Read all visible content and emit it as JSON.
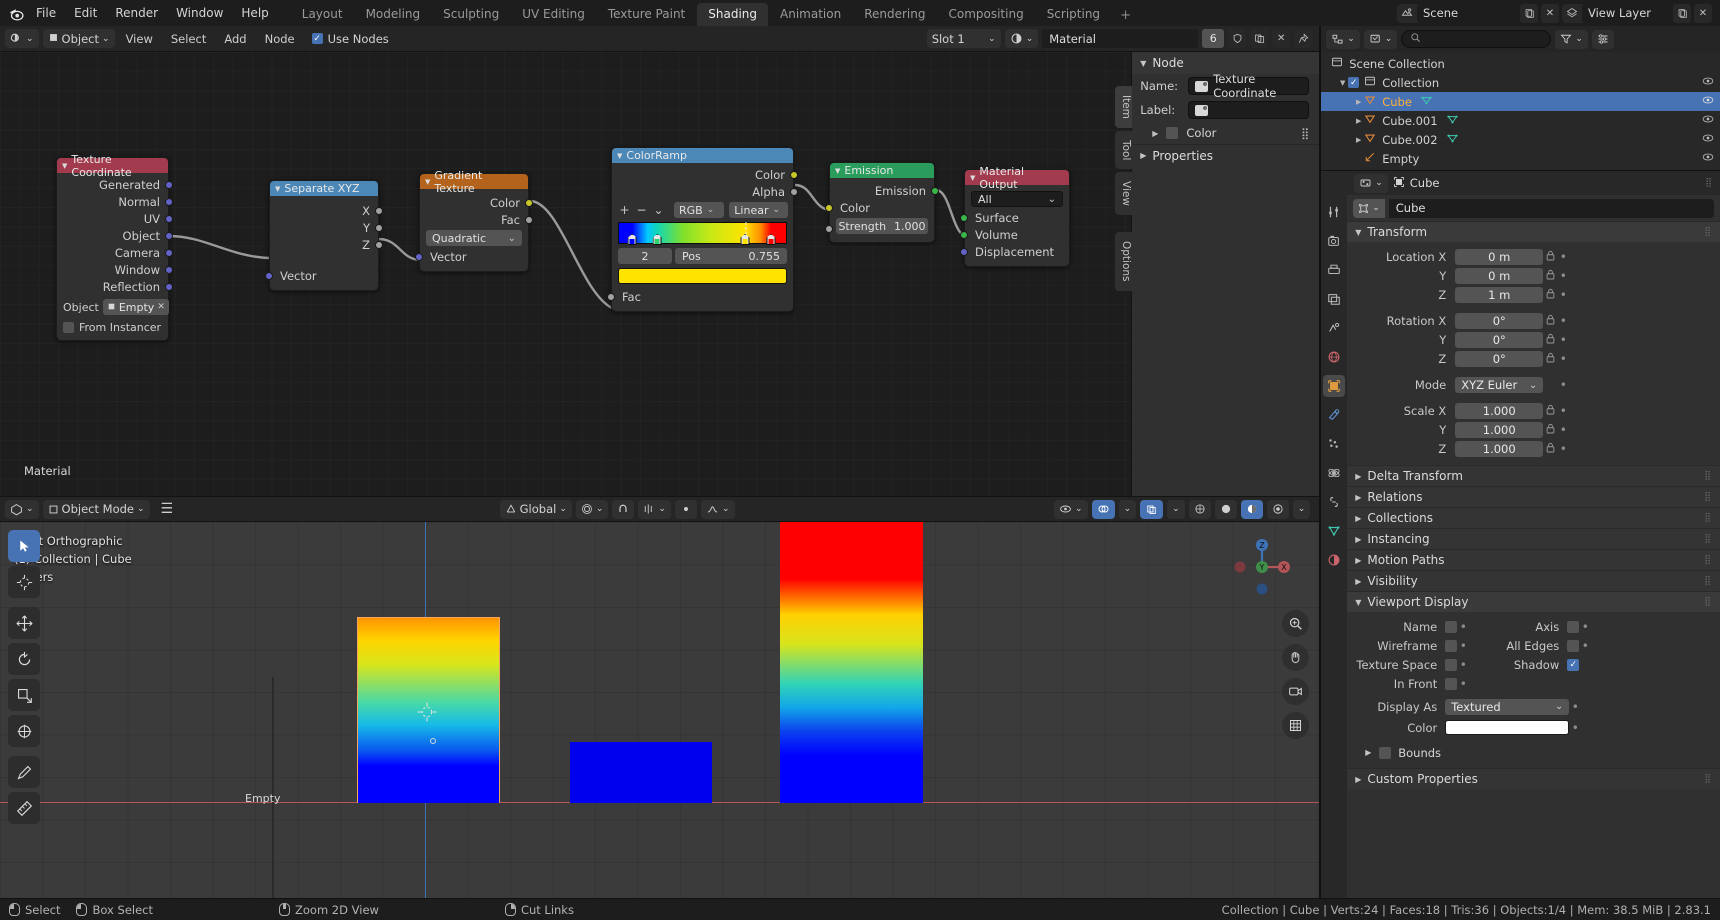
{
  "topbar": {
    "logo_icon": "blender-logo-icon",
    "menus": [
      "File",
      "Edit",
      "Render",
      "Window",
      "Help"
    ],
    "workspaces": [
      "Layout",
      "Modeling",
      "Sculpting",
      "UV Editing",
      "Texture Paint",
      "Shading",
      "Animation",
      "Rendering",
      "Compositing",
      "Scripting"
    ],
    "active_workspace": "Shading",
    "add_workspace": "+",
    "scene_name": "Scene",
    "viewlayer_name": "View Layer"
  },
  "node_header": {
    "editor_type_icon": "shader-editor-icon",
    "shader_type": "Object",
    "menus": [
      "View",
      "Select",
      "Add",
      "Node"
    ],
    "use_nodes_label": "Use Nodes",
    "use_nodes_checked": true,
    "slot": "Slot 1",
    "material_name": "Material",
    "users_count": "6",
    "shield_icon": "fake-user-icon",
    "copy_icon": "duplicate-icon",
    "x_icon": "unlink-icon",
    "pin_icon": "pin-icon"
  },
  "nodes": {
    "texture_coordinate": {
      "title": "Texture Coordinate",
      "header_color": "#a33b4e",
      "outputs": [
        "Generated",
        "Normal",
        "UV",
        "Object",
        "Camera",
        "Window",
        "Reflection"
      ],
      "object_label": "Object",
      "object_value": "Empty",
      "from_instancer_label": "From Instancer",
      "from_instancer_checked": false
    },
    "separate_xyz": {
      "title": "Separate XYZ",
      "header_color": "#4b87b7",
      "outputs": [
        "X",
        "Y",
        "Z"
      ],
      "inputs": [
        "Vector"
      ]
    },
    "gradient_texture": {
      "title": "Gradient Texture",
      "header_color": "#b3631b",
      "outputs": [
        "Color",
        "Fac"
      ],
      "type_value": "Quadratic",
      "inputs": [
        "Vector"
      ]
    },
    "color_ramp": {
      "title": "ColorRamp",
      "header_color": "#4b87b7",
      "outputs": [
        "Color",
        "Alpha"
      ],
      "inputs": [
        "Fac"
      ],
      "add_icon": "plus-icon",
      "remove_icon": "minus-icon",
      "dropdown_icon": "chevron-down-icon",
      "color_mode": "RGB",
      "interpolation": "Linear",
      "active_index": "2",
      "pos_label": "Pos",
      "pos_value": "0.755",
      "active_color": "#ffe400",
      "stops": [
        {
          "pos": 0.08,
          "color": "#0000ff",
          "selected": false
        },
        {
          "pos": 0.23,
          "color": "#2fd36e",
          "selected": false
        },
        {
          "pos": 0.755,
          "color": "#ffe400",
          "selected": true
        },
        {
          "pos": 0.91,
          "color": "#ff0000",
          "selected": false
        }
      ]
    },
    "emission": {
      "title": "Emission",
      "header_color": "#2a9d5c",
      "outputs": [
        "Emission"
      ],
      "inputs": [
        "Color"
      ],
      "strength_label": "Strength",
      "strength_value": "1.000"
    },
    "material_output": {
      "title": "Material Output",
      "header_color": "#a33b4e",
      "target_value": "All",
      "inputs": [
        "Surface",
        "Volume",
        "Displacement"
      ]
    }
  },
  "node_npanel": {
    "tabs": [
      "Item",
      "Tool",
      "View",
      "Options"
    ],
    "section_node": "Node",
    "name_label": "Name:",
    "name_value": "Texture Coordinate",
    "label_label": "Label:",
    "label_value": "",
    "color_label": "Color",
    "color_checked": false,
    "properties_label": "Properties",
    "list_icon": "list-icon"
  },
  "viewport_label": "Material",
  "viewport_header": {
    "editor_icon": "3d-viewport-icon",
    "mode": "Object Mode",
    "menu_icon": "hamburger-icon",
    "transform_orientation": "Global",
    "snap_icon": "magnet-icon",
    "proportional_icon": "proportional-edit-icon",
    "falloff_icon": "falloff-curve-icon",
    "overlay_icon": "overlays-icon",
    "xray_icon": "xray-icon",
    "shading_icons": [
      "wireframe-shading",
      "solid-shading",
      "material-preview-shading",
      "rendered-shading"
    ]
  },
  "viewport": {
    "info_line1": "Front Orthographic",
    "info_line2": "(1) Collection | Cube",
    "info_line3": "Meters",
    "empty_label": "Empty",
    "gizmo_axes": [
      "X",
      "Y",
      "Z"
    ],
    "tools": [
      "select-box-tool",
      "cursor-tool",
      "move-tool",
      "rotate-tool",
      "scale-tool",
      "transform-tool",
      "annotate-tool",
      "measure-tool"
    ],
    "overlay_buttons": [
      "zoom-icon",
      "hand-icon",
      "camera-icon",
      "grid-icon"
    ]
  },
  "outliner": {
    "display_mode_icon": "outliner-display-mode-icon",
    "filter_icon": "filter-icon",
    "search_placeholder": "",
    "search_icon": "search-icon",
    "rows": [
      {
        "label": "Scene Collection",
        "icon": "collection-icon",
        "depth": 0,
        "selected": false,
        "expandable": false,
        "checkbox": false,
        "visible": true
      },
      {
        "label": "Collection",
        "icon": "collection-icon",
        "depth": 1,
        "selected": false,
        "expandable": true,
        "checkbox": true,
        "visible": true
      },
      {
        "label": "Cube",
        "icon": "mesh-icon",
        "depth": 2,
        "selected": true,
        "expandable": true,
        "checkbox": false,
        "visible": true
      },
      {
        "label": "Cube.001",
        "icon": "mesh-icon",
        "depth": 2,
        "selected": false,
        "expandable": true,
        "checkbox": false,
        "visible": true
      },
      {
        "label": "Cube.002",
        "icon": "mesh-icon",
        "depth": 2,
        "selected": false,
        "expandable": true,
        "checkbox": false,
        "visible": true
      },
      {
        "label": "Empty",
        "icon": "empty-axis-icon",
        "depth": 2,
        "selected": false,
        "expandable": false,
        "checkbox": false,
        "visible": true
      }
    ]
  },
  "properties": {
    "breadcrumb_icon": "object-icon",
    "breadcrumb": "Cube",
    "id_name": "Cube",
    "tabs": [
      "tool-tab",
      "render-tab",
      "output-tab",
      "view-layer-tab",
      "scene-tab",
      "world-tab",
      "object-tab",
      "modifier-tab",
      "particles-tab",
      "physics-tab",
      "constraints-tab",
      "data-tab",
      "material-tab"
    ],
    "active_tab_index": 6,
    "transform": {
      "title": "Transform",
      "location_label": "Location X",
      "location": [
        "0 m",
        "0 m",
        "1 m"
      ],
      "rotation_label": "Rotation X",
      "rotation": [
        "0°",
        "0°",
        "0°"
      ],
      "axes": [
        "X",
        "Y",
        "Z"
      ],
      "mode_label": "Mode",
      "mode_value": "XYZ Euler",
      "scale_label": "Scale X",
      "scale": [
        "1.000",
        "1.000",
        "1.000"
      ]
    },
    "sections": [
      "Delta Transform",
      "Relations",
      "Collections",
      "Instancing",
      "Motion Paths",
      "Visibility"
    ],
    "viewport_display": {
      "title": "Viewport Display",
      "left_items": [
        {
          "label": "Name",
          "checked": false
        },
        {
          "label": "Wireframe",
          "checked": false
        },
        {
          "label": "Texture Space",
          "checked": false
        },
        {
          "label": "In Front",
          "checked": false
        }
      ],
      "right_items": [
        {
          "label": "Axis",
          "checked": false
        },
        {
          "label": "All Edges",
          "checked": false
        },
        {
          "label": "Shadow",
          "checked": true
        }
      ],
      "display_as_label": "Display As",
      "display_as_value": "Textured",
      "color_label": "Color",
      "color_value": "#ffffff"
    },
    "bounds_label": "Bounds",
    "bounds_checked": false,
    "custom_properties_label": "Custom Properties"
  },
  "statusbar": {
    "items": [
      {
        "icon": "mouse-left-icon",
        "label": "Select"
      },
      {
        "icon": "mouse-drag-icon",
        "label": "Box Select"
      },
      {
        "icon": "mouse-middle-icon",
        "label": "Zoom 2D View"
      },
      {
        "icon": "mouse-right-icon",
        "label": "Cut Links"
      }
    ],
    "stats": "Collection | Cube | Verts:24 | Faces:18 | Tris:36 | Objects:1/4 | Mem: 38.5 MiB | 2.83.1"
  }
}
